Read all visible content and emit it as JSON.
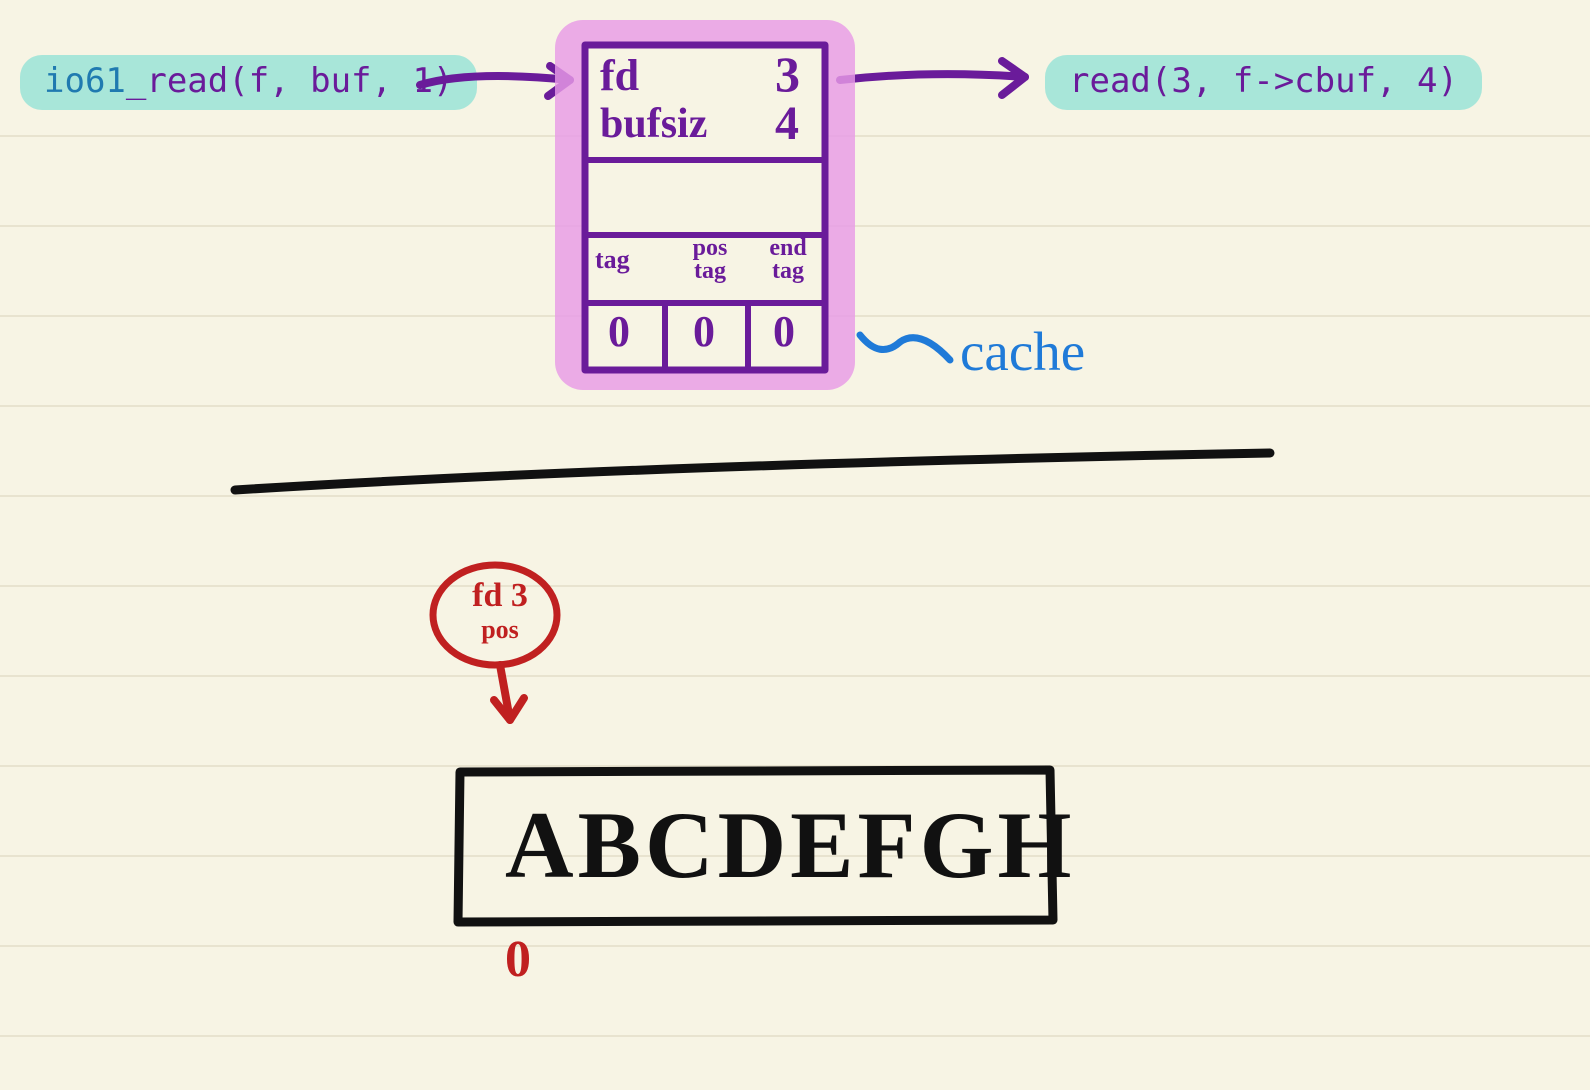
{
  "call_left": {
    "fn": "io61",
    "rest": "_read(f, buf, 1)"
  },
  "call_right": "read(3, f->cbuf, 4)",
  "struct": {
    "fd_label": "fd",
    "fd_val": "3",
    "bufsiz_label": "bufsiz",
    "bufsiz_val": "4",
    "col1_top": "tag",
    "col2_top": "pos",
    "col2_bot": "tag",
    "col3_top": "end",
    "col3_bot": "tag",
    "v1": "0",
    "v2": "0",
    "v3": "0"
  },
  "cache_label": "cache",
  "fd_marker": {
    "line1": "fd 3",
    "line2": "pos"
  },
  "file_contents": "ABCDEFGH",
  "zero_marker": "0"
}
